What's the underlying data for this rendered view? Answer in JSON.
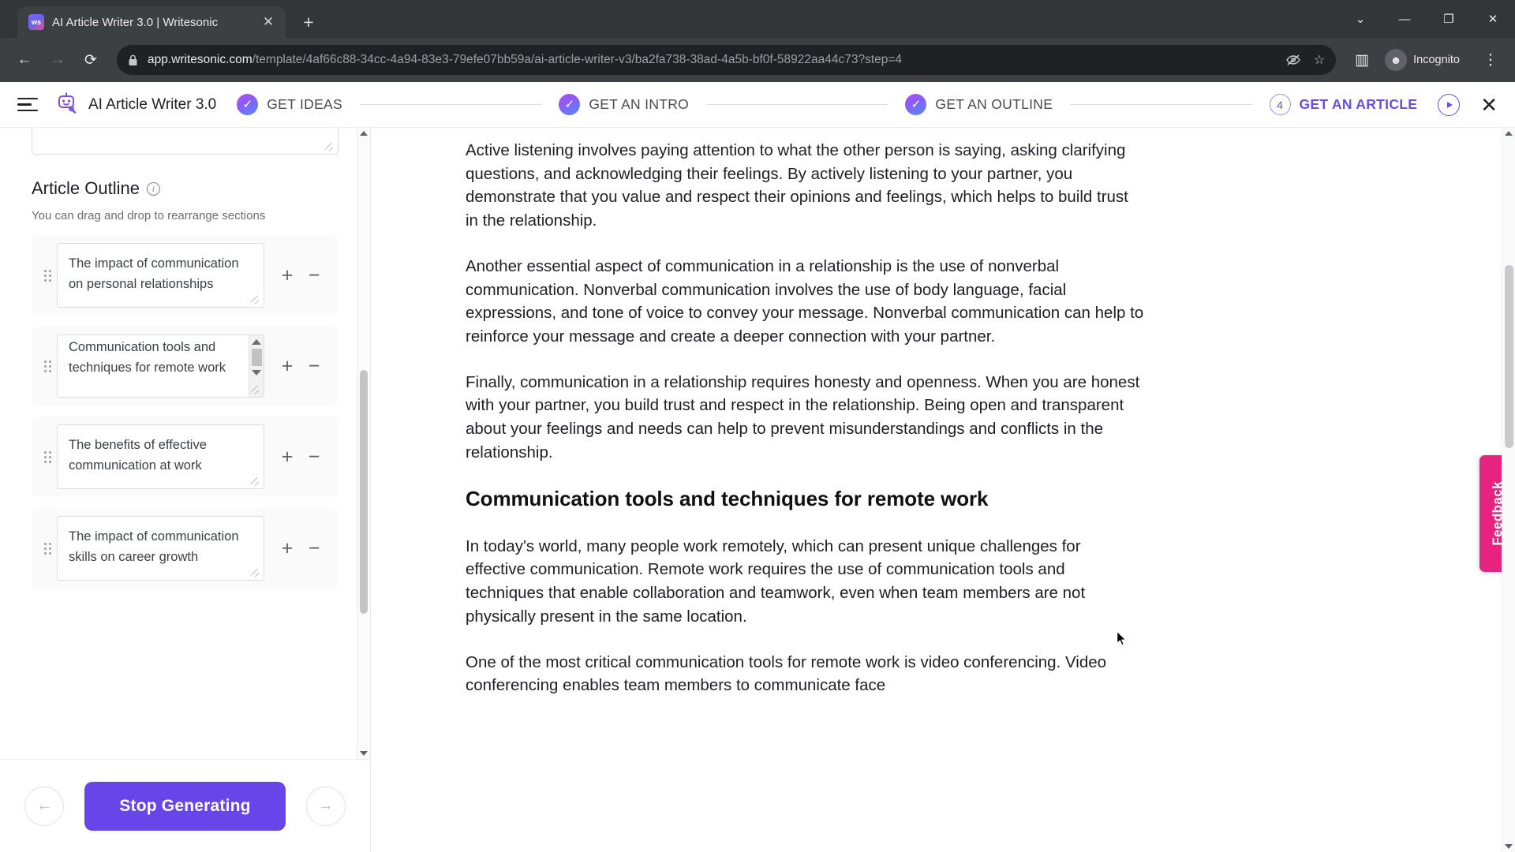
{
  "browser": {
    "tab": {
      "title": "AI Article Writer 3.0 | Writesonic",
      "favicon": "ws",
      "close_icon": "✕"
    },
    "new_tab_icon": "+",
    "window_controls": {
      "minimize_chevron": "⌄",
      "minimize": "—",
      "maximize": "❐",
      "close": "✕"
    },
    "nav": {
      "back_icon": "←",
      "forward_icon": "→",
      "reload_icon": "⟳"
    },
    "omnibox": {
      "lock_icon": "🔒",
      "url_host": "app.writesonic.com",
      "url_path": "/template/4af66c88-34cc-4a94-83e3-79efe07bb59a/ai-article-writer-v3/ba2fa738-38ad-4a5b-bf0f-58922aa44c73?step=4",
      "eye_off_icon": "⦸",
      "bookmark_icon": "☆"
    },
    "sidepanel_icon": "▥",
    "incognito_label": "Incognito",
    "incognito_avatar_icon": "☻",
    "menu_icon": "⋮"
  },
  "app_header": {
    "menu_icon": "hamburger-icon",
    "logo_icon": "robot-pen-icon",
    "title": "AI Article Writer 3.0",
    "steps": [
      {
        "label": "GET IDEAS",
        "state": "done",
        "marker": "✓"
      },
      {
        "label": "GET AN INTRO",
        "state": "done",
        "marker": "✓"
      },
      {
        "label": "GET AN OUTLINE",
        "state": "done",
        "marker": "✓"
      },
      {
        "label": "GET AN ARTICLE",
        "state": "active",
        "marker": "4"
      }
    ],
    "play_icon": "play-circle-icon",
    "close_icon": "✕",
    "accent_color": "#6750e0"
  },
  "left_panel": {
    "outline_title": "Article Outline",
    "info_icon": "i",
    "outline_subtitle": "You can drag and drop to rearrange sections",
    "sections": [
      {
        "text": "The impact of communication on personal relationships",
        "clipped": false,
        "add": "+",
        "remove": "−"
      },
      {
        "text": "Communication tools and techniques for remote work",
        "clipped": true,
        "add": "+",
        "remove": "−"
      },
      {
        "text": "The benefits of effective communication at work",
        "clipped": false,
        "add": "+",
        "remove": "−"
      },
      {
        "text": "The impact of communication skills on career growth",
        "clipped": false,
        "add": "+",
        "remove": "−"
      }
    ],
    "footer": {
      "back_icon": "←",
      "primary_label": "Stop Generating",
      "next_icon": "→",
      "primary_color": "#6845e8"
    }
  },
  "article": {
    "paragraphs": [
      "Active listening involves paying attention to what the other person is saying, asking clarifying questions, and acknowledging their feelings. By actively listening to your partner, you demonstrate that you value and respect their opinions and feelings, which helps to build trust in the relationship.",
      "Another essential aspect of communication in a relationship is the use of nonverbal communication. Nonverbal communication involves the use of body language, facial expressions, and tone of voice to convey your message. Nonverbal communication can help to reinforce your message and create a deeper connection with your partner.",
      "Finally, communication in a relationship requires honesty and openness. When you are honest with your partner, you build trust and respect in the relationship. Being open and transparent about your feelings and needs can help to prevent misunderstandings and conflicts in the relationship."
    ],
    "heading": "Communication tools and techniques for remote work",
    "paragraphs_after": [
      "In today's world, many people work remotely, which can present unique challenges for effective communication. Remote work requires the use of communication tools and techniques that enable collaboration and teamwork, even when team members are not physically present in the same location.",
      "One of the most critical communication tools for remote work is video conferencing. Video conferencing enables team members to communicate face"
    ]
  },
  "feedback": {
    "label": "Feedback",
    "color": "#e6237e"
  }
}
